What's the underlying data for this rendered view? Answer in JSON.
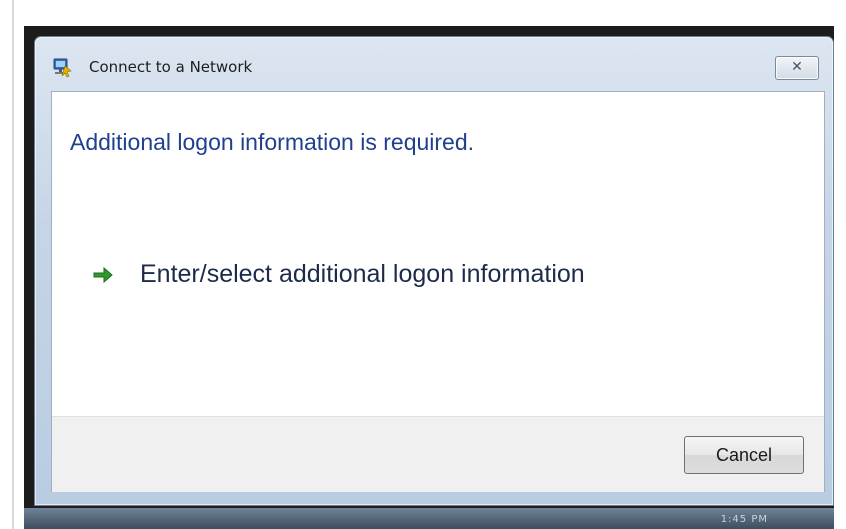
{
  "window": {
    "title": "Connect to a Network",
    "close_glyph": "✕",
    "title_icon": "network-icon"
  },
  "main": {
    "heading": "Additional logon information is required.",
    "link_label": "Enter/select additional logon information",
    "link_icon": "green-arrow-icon"
  },
  "footer": {
    "cancel_label": "Cancel"
  },
  "taskbar": {
    "text": "1:45 PM"
  },
  "colors": {
    "heading": "#1f3f8f",
    "arrow": "#2e9a2e",
    "window_frame": "#c6d5e6"
  }
}
